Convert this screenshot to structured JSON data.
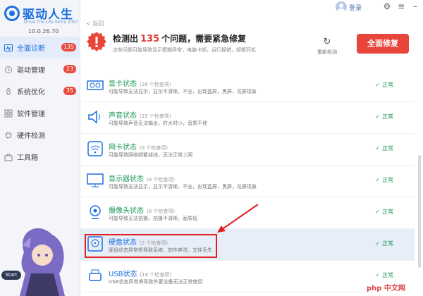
{
  "app": {
    "title": "驱动人生",
    "tagline": "Drive The Life  Since 2007",
    "version": "10.0.26.70"
  },
  "sidebar": {
    "items": [
      {
        "label": "全面诊断",
        "badge": "135",
        "icon": "pulse-icon"
      },
      {
        "label": "驱动管理",
        "badge": "23",
        "icon": "refresh-icon"
      },
      {
        "label": "系统优化",
        "badge": "35",
        "icon": "rocket-icon"
      },
      {
        "label": "软件管理",
        "badge": "",
        "icon": "grid-icon"
      },
      {
        "label": "硬件检测",
        "badge": "",
        "icon": "chip-icon"
      },
      {
        "label": "工具箱",
        "badge": "",
        "icon": "toolbox-icon"
      }
    ],
    "start_label": "Start"
  },
  "topbar": {
    "back_label": "< 返回",
    "login_label": "登录"
  },
  "alert": {
    "title_prefix": "检测出",
    "count": "135",
    "title_suffix": "个问题，需要紧急修复",
    "subtitle": "这些问题可能导致显示模糊异常，电脑卡顿，运行报错，频繁死机",
    "redetect_label": "重新检测",
    "fix_label": "全面修复"
  },
  "rows": [
    {
      "title": "显卡状态",
      "count": "(16 个检查项)",
      "desc": "可能导致无法显示，显示不清晰，不全，出现蓝屏，黑屏，花屏现象",
      "status": "正常",
      "icon": "graphics-card-icon"
    },
    {
      "title": "声音状态",
      "count": "(15 个检查项)",
      "desc": "可能导致声音无法输出，时大时小，音质不佳",
      "status": "正常",
      "icon": "speaker-icon"
    },
    {
      "title": "网卡状态",
      "count": "(9 个检查项)",
      "desc": "可能导致网络频繁掉线，无法正常上网",
      "status": "正常",
      "icon": "wifi-icon"
    },
    {
      "title": "显示器状态",
      "count": "(8 个检查项)",
      "desc": "可能导致无法显示，显示不清晰，不全，出现蓝屏，黑屏，花屏现象",
      "status": "正常",
      "icon": "monitor-icon"
    },
    {
      "title": "摄像头状态",
      "count": "(8 个检查项)",
      "desc": "可能导致无法拍摄，拍摄不清晰，画质低",
      "status": "正常",
      "icon": "webcam-icon"
    },
    {
      "title": "硬盘状态",
      "count": "(2 个检查项)",
      "desc": "硬盘状态异常将导致系统、软件奔溃、文件丢失",
      "status": "正常",
      "icon": "hard-disk-icon"
    },
    {
      "title": "USB状态",
      "count": "(18 个检查项)",
      "desc": "USB状态异常将导致外置设备无法正常使用",
      "status": "正常",
      "icon": "usb-icon"
    }
  ],
  "watermark": "php 中文网"
}
